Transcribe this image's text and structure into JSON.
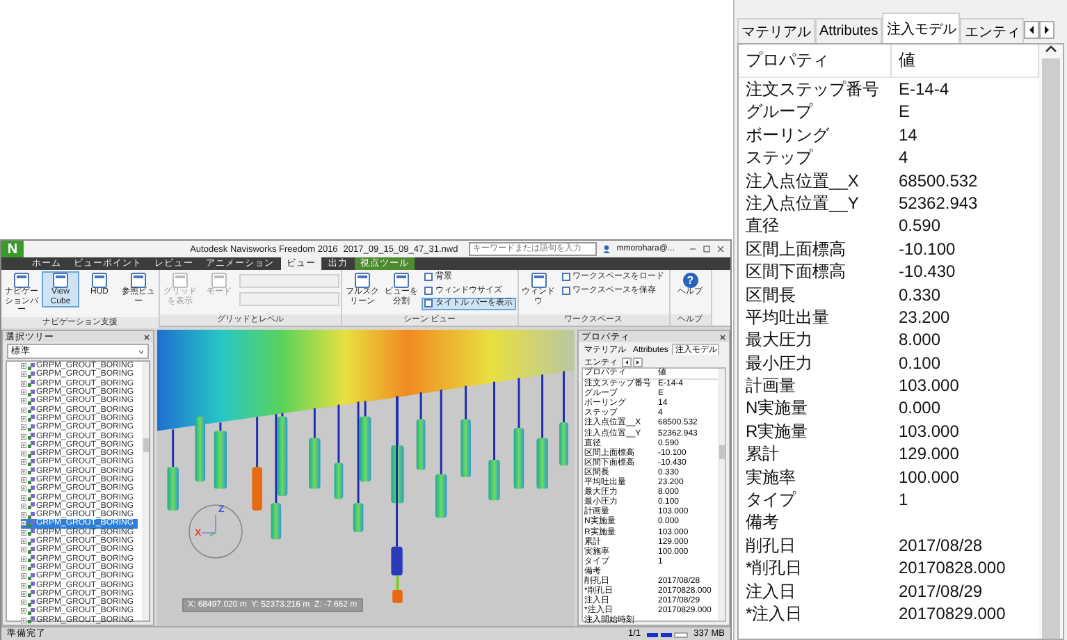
{
  "app_window": {
    "logo": "N",
    "title": "Autodesk Navisworks Freedom 2016",
    "file_name": "2017_09_15_09_47_31.nwd",
    "search": {
      "placeholder": "キーワードまたは語句を入力"
    },
    "user": "mmorohara@...",
    "ribbon_tabs": [
      {
        "label": "ホーム",
        "selected": false,
        "kind": "tab"
      },
      {
        "label": "ビューポイント",
        "selected": false,
        "kind": "tab"
      },
      {
        "label": "レビュー",
        "selected": false,
        "kind": "tab"
      },
      {
        "label": "アニメーション",
        "selected": false,
        "kind": "tab"
      },
      {
        "label": "ビュー",
        "selected": true,
        "kind": "tab"
      },
      {
        "label": "出力",
        "selected": false,
        "kind": "tab"
      },
      {
        "label": "視点ツール",
        "selected": false,
        "kind": "contextual"
      }
    ],
    "ribbon_groups": [
      {
        "title": "ナビゲーション支援",
        "buttons": [
          {
            "label": "ナビゲーションバー",
            "kind": "large",
            "selected": false,
            "disabled": false
          },
          {
            "label": "View Cube",
            "kind": "large",
            "selected": true,
            "disabled": false
          },
          {
            "label": "HUD",
            "kind": "large",
            "selected": false,
            "disabled": false
          },
          {
            "label": "参照ビュー",
            "kind": "large",
            "selected": false,
            "disabled": false
          }
        ]
      },
      {
        "title": "グリッドとレベル",
        "buttons": [
          {
            "label": "グリッドを表示",
            "kind": "large",
            "selected": false,
            "disabled": true
          },
          {
            "label": "モード",
            "kind": "large",
            "selected": false,
            "disabled": true
          },
          {
            "kind": "combo",
            "disabled": true
          }
        ]
      },
      {
        "title": "シーン ビュー",
        "buttons": [
          {
            "label": "フルスクリーン",
            "kind": "large",
            "selected": false,
            "disabled": false
          },
          {
            "label": "ビューを分割",
            "kind": "large",
            "selected": false,
            "disabled": false
          },
          {
            "label": "背景",
            "kind": "small",
            "selected": false,
            "disabled": false
          },
          {
            "label": "ウィンドウサイズ",
            "kind": "small",
            "selected": false,
            "disabled": false
          },
          {
            "label": "タイトル バーを表示",
            "kind": "small",
            "selected": true,
            "disabled": false
          }
        ]
      },
      {
        "title": "ワークスペース",
        "buttons": [
          {
            "label": "ウィンドウ",
            "kind": "large",
            "selected": false,
            "disabled": false
          },
          {
            "label": "ワークスペースをロード",
            "kind": "small",
            "selected": false,
            "disabled": false
          },
          {
            "label": "ワークスペースを保存",
            "kind": "small",
            "selected": false,
            "disabled": false
          }
        ]
      },
      {
        "title": "ヘルプ",
        "buttons": [
          {
            "label": "ヘルプ",
            "kind": "help",
            "glyph": "?",
            "selected": false,
            "disabled": false
          }
        ]
      }
    ],
    "selection_tree": {
      "title": "選択ツリー",
      "dropdown": "標準",
      "items": [
        {
          "label": "GRPM_GROUT_BORING",
          "selected": false
        },
        {
          "label": "GRPM_GROUT_BORING",
          "selected": false
        },
        {
          "label": "GRPM_GROUT_BORING",
          "selected": false
        },
        {
          "label": "GRPM_GROUT_BORING",
          "selected": false
        },
        {
          "label": "GRPM_GROUT_BORING",
          "selected": false
        },
        {
          "label": "GRPM_GROUT_BORING",
          "selected": false
        },
        {
          "label": "GRPM_GROUT_BORING",
          "selected": false
        },
        {
          "label": "GRPM_GROUT_BORING",
          "selected": false
        },
        {
          "label": "GRPM_GROUT_BORING",
          "selected": false
        },
        {
          "label": "GRPM_GROUT_BORING",
          "selected": false
        },
        {
          "label": "GRPM_GROUT_BORING",
          "selected": false
        },
        {
          "label": "GRPM_GROUT_BORING",
          "selected": false
        },
        {
          "label": "GRPM_GROUT_BORING",
          "selected": false
        },
        {
          "label": "GRPM_GROUT_BORING",
          "selected": false
        },
        {
          "label": "GRPM_GROUT_BORING",
          "selected": false
        },
        {
          "label": "GRPM_GROUT_BORING",
          "selected": false
        },
        {
          "label": "GRPM_GROUT_BORING",
          "selected": false
        },
        {
          "label": "GRPM_GROUT_BORING",
          "selected": false
        },
        {
          "label": "GRPM_GROUT_BORING",
          "selected": true
        },
        {
          "label": "GRPM_GROUT_BORING",
          "selected": false
        },
        {
          "label": "GRPM_GROUT_BORING",
          "selected": false
        },
        {
          "label": "GRPM_GROUT_BORING",
          "selected": false
        },
        {
          "label": "GRPM_GROUT_BORING",
          "selected": false
        },
        {
          "label": "GRPM_GROUT_BORING",
          "selected": false
        },
        {
          "label": "GRPM_GROUT_BORING",
          "selected": false
        },
        {
          "label": "GRPM_GROUT_BORING",
          "selected": false
        },
        {
          "label": "GRPM_GROUT_BORING",
          "selected": false
        },
        {
          "label": "GRPM_GROUT_BORING",
          "selected": false
        },
        {
          "label": "GRPM_GROUT_BORING",
          "selected": false
        },
        {
          "label": "GRPM_GROUT_BORING",
          "selected": false
        }
      ]
    },
    "viewport": {
      "axis_labels": [
        "Z",
        "X"
      ],
      "coordinates": "X: 68497.020 m  Y: 52373.216 m  Z: -7.662 m"
    },
    "properties_panel": {
      "title": "プロパティ",
      "tabs": [
        {
          "label": "マテリアル",
          "selected": false
        },
        {
          "label": "Attributes",
          "selected": false
        },
        {
          "label": "注入モデル",
          "selected": true
        },
        {
          "label": "エンティ",
          "selected": false
        }
      ],
      "columns": [
        "プロパティ",
        "値"
      ],
      "rows": [
        {
          "name": "注文ステップ番号",
          "value": "E-14-4"
        },
        {
          "name": "グループ",
          "value": "E"
        },
        {
          "name": "ボーリング",
          "value": "14"
        },
        {
          "name": "ステップ",
          "value": "4"
        },
        {
          "name": "注入点位置__X",
          "value": "68500.532"
        },
        {
          "name": "注入点位置__Y",
          "value": "52362.943"
        },
        {
          "name": "直径",
          "value": "0.590"
        },
        {
          "name": "区間上面標高",
          "value": "-10.100"
        },
        {
          "name": "区間下面標高",
          "value": "-10.430"
        },
        {
          "name": "区間長",
          "value": "0.330"
        },
        {
          "name": "平均吐出量",
          "value": "23.200"
        },
        {
          "name": "最大圧力",
          "value": "8.000"
        },
        {
          "name": "最小圧力",
          "value": "0.100"
        },
        {
          "name": "計画量",
          "value": "103.000"
        },
        {
          "name": "N実施量",
          "value": "0.000"
        },
        {
          "name": "R実施量",
          "value": "103.000"
        },
        {
          "name": "累計",
          "value": "129.000"
        },
        {
          "name": "実施率",
          "value": "100.000"
        },
        {
          "name": "タイプ",
          "value": "1"
        },
        {
          "name": "備考",
          "value": ""
        },
        {
          "name": "削孔日",
          "value": "2017/08/28"
        },
        {
          "name": "*削孔日",
          "value": "20170828.000"
        },
        {
          "name": "注入日",
          "value": "2017/08/29"
        },
        {
          "name": "*注入日",
          "value": "20170829.000"
        },
        {
          "name": "注入開始時刻",
          "value": ""
        }
      ]
    },
    "status_bar": {
      "text": "準備完了",
      "page": "1/1",
      "memory": "337 MB"
    }
  },
  "properties": {
    "tabs": [
      {
        "label": "マテリアル",
        "selected": false
      },
      {
        "label": "Attributes",
        "selected": false
      },
      {
        "label": "注入モデル",
        "selected": true
      },
      {
        "label": "エンティ",
        "selected": false
      }
    ],
    "columns": [
      "プロパティ",
      "値"
    ],
    "rows": [
      {
        "name": "注文ステップ番号",
        "value": "E-14-4"
      },
      {
        "name": "グループ",
        "value": "E"
      },
      {
        "name": "ボーリング",
        "value": "14"
      },
      {
        "name": "ステップ",
        "value": "4"
      },
      {
        "name": "注入点位置__X",
        "value": "68500.532"
      },
      {
        "name": "注入点位置__Y",
        "value": "52362.943"
      },
      {
        "name": "直径",
        "value": "0.590"
      },
      {
        "name": "区間上面標高",
        "value": "-10.100"
      },
      {
        "name": "区間下面標高",
        "value": "-10.430"
      },
      {
        "name": "区間長",
        "value": "0.330"
      },
      {
        "name": "平均吐出量",
        "value": "23.200"
      },
      {
        "name": "最大圧力",
        "value": "8.000"
      },
      {
        "name": "最小圧力",
        "value": "0.100"
      },
      {
        "name": "計画量",
        "value": "103.000"
      },
      {
        "name": "N実施量",
        "value": "0.000"
      },
      {
        "name": "R実施量",
        "value": "103.000"
      },
      {
        "name": "累計",
        "value": "129.000"
      },
      {
        "name": "実施率",
        "value": "100.000"
      },
      {
        "name": "タイプ",
        "value": "1"
      },
      {
        "name": "備考",
        "value": ""
      },
      {
        "name": "削孔日",
        "value": "2017/08/28"
      },
      {
        "name": "*削孔日",
        "value": "20170828.000"
      },
      {
        "name": "注入日",
        "value": "2017/08/29"
      },
      {
        "name": "*注入日",
        "value": "20170829.000"
      }
    ]
  }
}
